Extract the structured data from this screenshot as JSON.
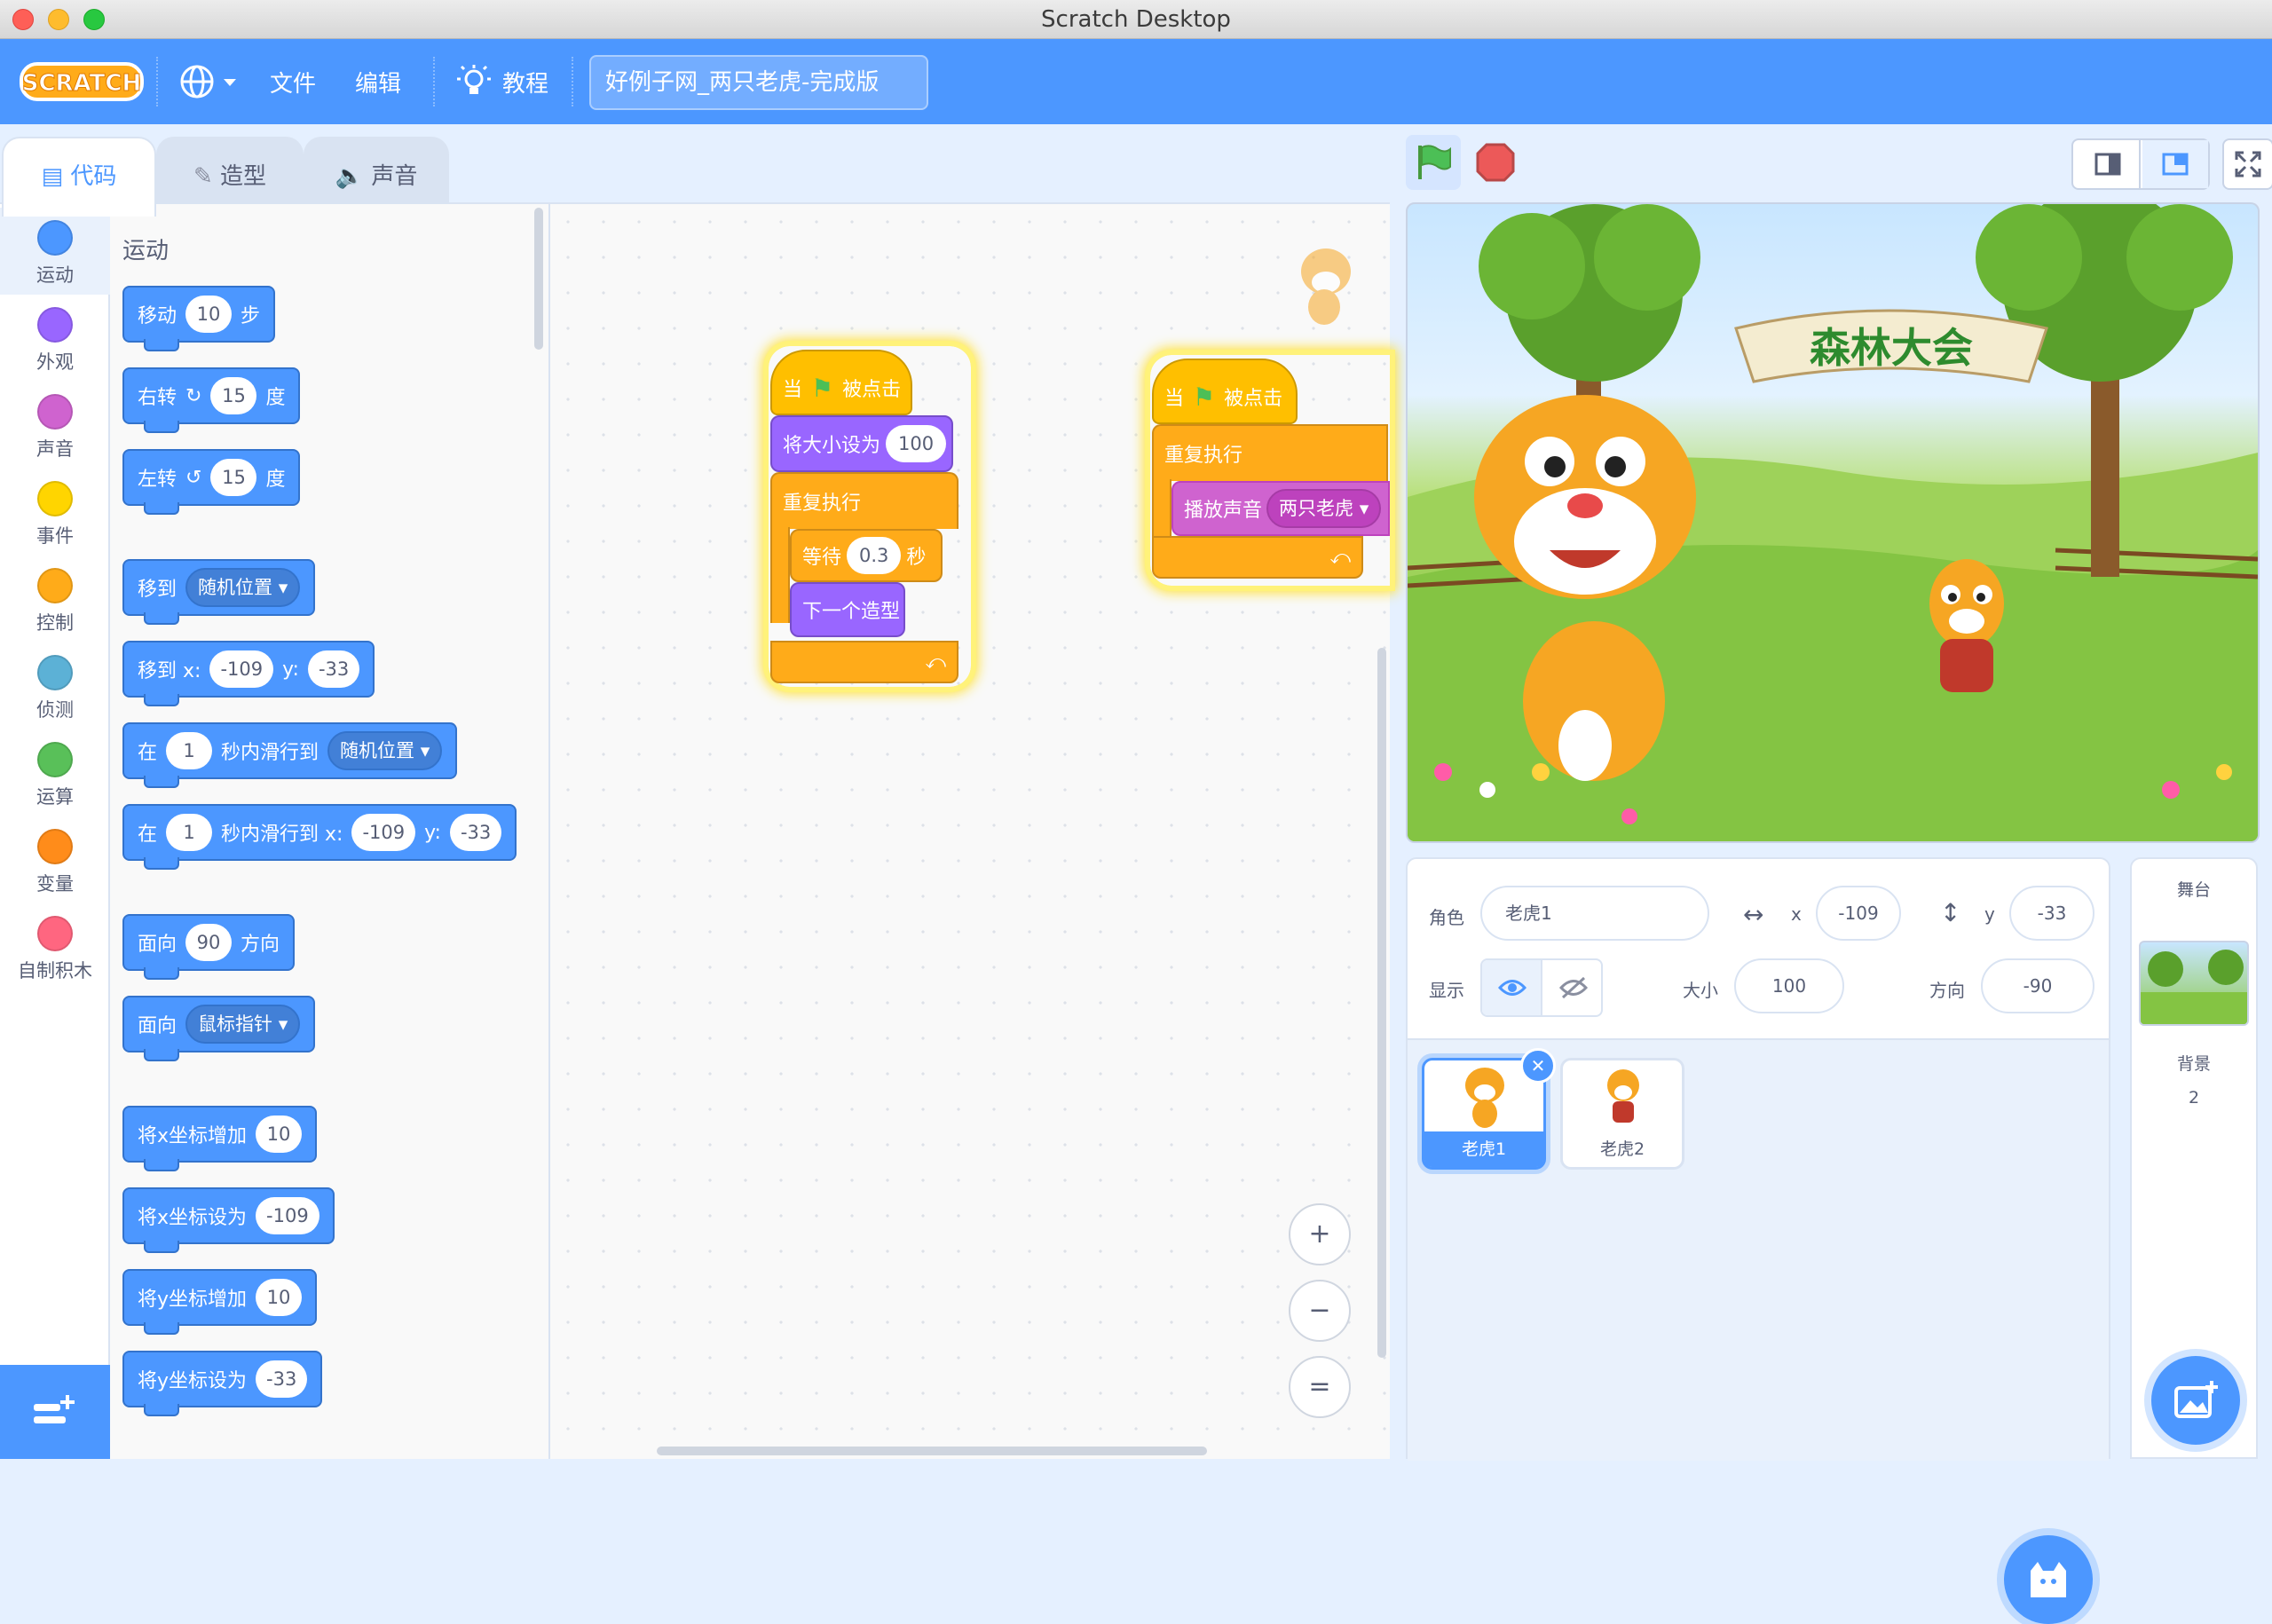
{
  "window": {
    "title": "Scratch Desktop"
  },
  "menubar": {
    "logo": "SCRATCH",
    "file": "文件",
    "edit": "编辑",
    "tutorials": "教程",
    "project_title": "好例子网_两只老虎-完成版"
  },
  "tabs": [
    {
      "label": "代码",
      "icon": "code-icon"
    },
    {
      "label": "造型",
      "icon": "brush-icon"
    },
    {
      "label": "声音",
      "icon": "speaker-icon"
    }
  ],
  "categories": [
    {
      "label": "运动",
      "color": "#4c97ff"
    },
    {
      "label": "外观",
      "color": "#9966ff"
    },
    {
      "label": "声音",
      "color": "#cf63cf"
    },
    {
      "label": "事件",
      "color": "#ffd500"
    },
    {
      "label": "控制",
      "color": "#ffab19"
    },
    {
      "label": "侦测",
      "color": "#5cb1d6"
    },
    {
      "label": "运算",
      "color": "#59c059"
    },
    {
      "label": "变量",
      "color": "#ff8c1a"
    },
    {
      "label": "自制积木",
      "color": "#ff6680"
    }
  ],
  "palette": {
    "title": "运动",
    "move": {
      "a": "移动",
      "v": "10",
      "b": "步"
    },
    "turn_right": {
      "a": "右转",
      "v": "15",
      "b": "度"
    },
    "turn_left": {
      "a": "左转",
      "v": "15",
      "b": "度"
    },
    "goto": {
      "a": "移到",
      "dd": "随机位置"
    },
    "goto_xy": {
      "a": "移到 x:",
      "x": "-109",
      "b": "y:",
      "y": "-33"
    },
    "glide_random": {
      "a": "在",
      "v": "1",
      "b": "秒内滑行到",
      "dd": "随机位置"
    },
    "glide_xy": {
      "a": "在",
      "v": "1",
      "b": "秒内滑行到 x:",
      "x": "-109",
      "c": "y:",
      "y": "-33"
    },
    "point_dir": {
      "a": "面向",
      "v": "90",
      "b": "方向"
    },
    "point_towards": {
      "a": "面向",
      "dd": "鼠标指针"
    },
    "change_x": {
      "a": "将x坐标增加",
      "v": "10"
    },
    "set_x": {
      "a": "将x坐标设为",
      "v": "-109"
    },
    "change_y": {
      "a": "将y坐标增加",
      "v": "10"
    },
    "set_y": {
      "a": "将y坐标设为",
      "v": "-33"
    }
  },
  "script1": {
    "hat_a": "当",
    "hat_b": "被点击",
    "set_size": "将大小设为",
    "size_val": "100",
    "forever": "重复执行",
    "wait": "等待",
    "wait_val": "0.3",
    "wait_unit": "秒",
    "next_costume": "下一个造型"
  },
  "script2": {
    "hat_a": "当",
    "hat_b": "被点击",
    "forever": "重复执行",
    "play_sound": "播放声音",
    "sound_name": "两只老虎"
  },
  "zoom": {
    "in": "+",
    "out": "−",
    "reset": "="
  },
  "stage": {
    "banner": "森林大会"
  },
  "sprite_info": {
    "sprite_label": "角色",
    "sprite_name": "老虎1",
    "x_label": "x",
    "x_value": "-109",
    "y_label": "y",
    "y_value": "-33",
    "show_label": "显示",
    "size_label": "大小",
    "size_value": "100",
    "direction_label": "方向",
    "direction_value": "-90"
  },
  "sprites": [
    {
      "name": "老虎1",
      "selected": true
    },
    {
      "name": "老虎2",
      "selected": false
    }
  ],
  "stage_panel": {
    "title": "舞台",
    "backdrop_label": "背景",
    "backdrop_count": "2"
  }
}
